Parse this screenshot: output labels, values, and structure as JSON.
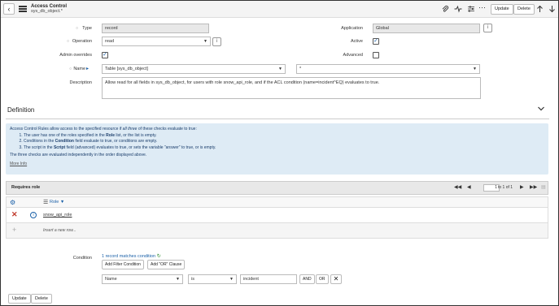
{
  "header": {
    "title": "Access Control",
    "subtitle": "sys_db_object.*",
    "update_label": "Update",
    "delete_label": "Delete"
  },
  "form": {
    "type_label": "Type",
    "type_value": "record",
    "application_label": "Application",
    "application_value": "Global",
    "operation_label": "Operation",
    "operation_value": "read",
    "active_label": "Active",
    "active_checked": true,
    "admin_overrides_label": "Admin overrides",
    "admin_overrides_checked": true,
    "advanced_label": "Advanced",
    "advanced_checked": false,
    "name_label": "Name",
    "name_table_value": "Table [sys_db_object]",
    "name_field_value": "*",
    "description_label": "Description",
    "description_value": "Allow read for all fields in sys_db_object, for users with role snow_api_role, and if the ACL condition (name=incident^EQ) evaluates to true."
  },
  "definition": {
    "title": "Definition",
    "info_intro_pre": "Access Control Rules allow access to the specified resource if ",
    "info_intro_em": "all three",
    "info_intro_post": " of these checks evaluate to true:",
    "item1_pre": "The user has one of the roles specified in the ",
    "item1_bold": "Role",
    "item1_post": " list, or the list is empty.",
    "item2_pre": "Conditions in the ",
    "item2_bold": "Condition",
    "item2_post": " field evaluate to true, or conditions are empty.",
    "item3_pre": "The script in the ",
    "item3_bold": "Script",
    "item3_post": " field (advanced) evaluates to true, or sets the variable \"answer\" to true, or is empty.",
    "info_footer": "The three checks are evaluated independently in the order displayed above.",
    "more_info": "More Info"
  },
  "requires_role": {
    "title": "Requires role",
    "page_value": "1",
    "page_of": "to 1 of 1",
    "column_role": "Role",
    "rows": [
      {
        "role": "snow_api_role"
      }
    ],
    "insert_placeholder": "Insert a new row..."
  },
  "condition": {
    "label": "Condition",
    "records_match": "1 record matches condition",
    "add_filter": "Add Filter Condition",
    "add_or": "Add \"OR\" Clause",
    "field_value": "Name",
    "operator_value": "is",
    "input_value": "incident",
    "and_label": "AND",
    "or_label": "OR"
  },
  "footer": {
    "update_label": "Update",
    "delete_label": "Delete"
  },
  "colors": {
    "info_bg": "#deebf5",
    "check_color": "#1a60a8",
    "delete_x": "#c0392b",
    "link": "#1a60a8"
  }
}
